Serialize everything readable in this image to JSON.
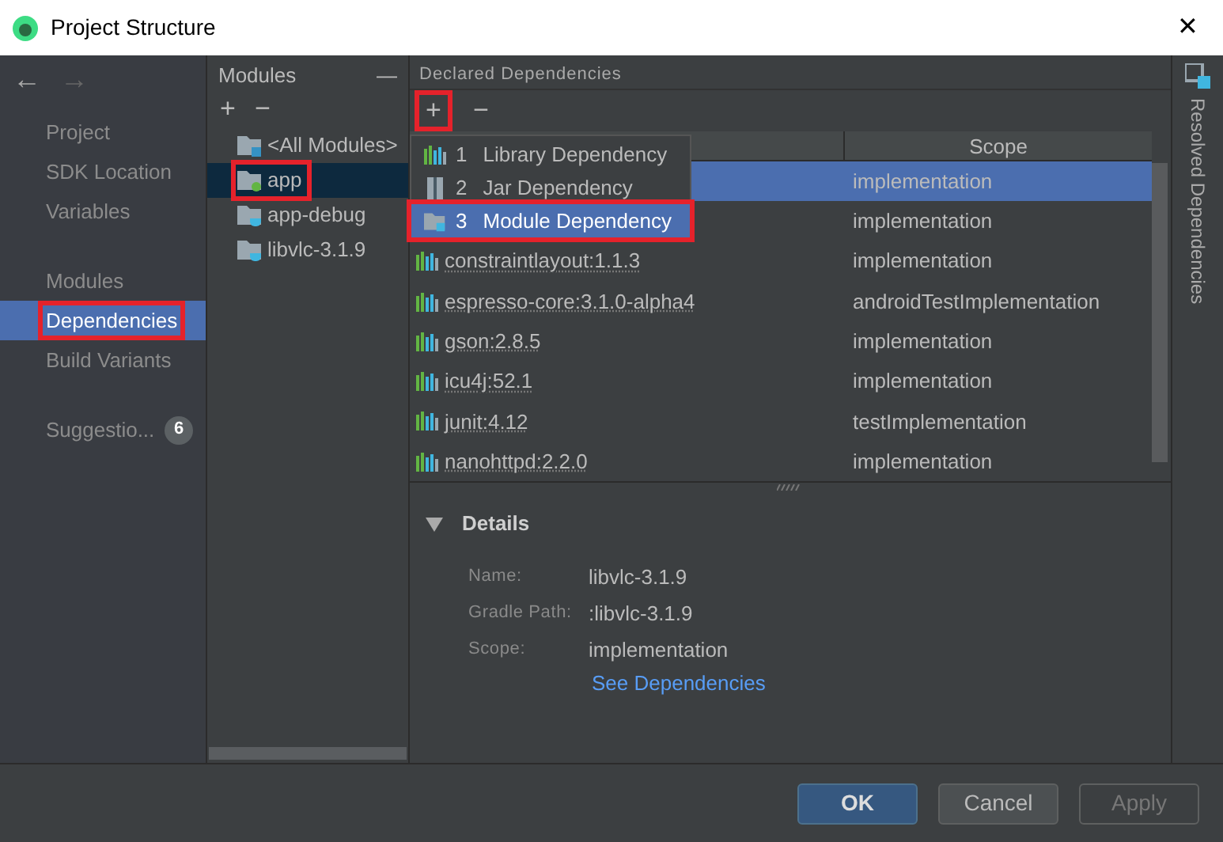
{
  "window": {
    "title": "Project Structure",
    "close": "✕"
  },
  "nav": {
    "back": "←",
    "forward": "→"
  },
  "sidebar": {
    "groups": [
      {
        "items": [
          {
            "label": "Project",
            "selected": false,
            "outlined": false
          },
          {
            "label": "SDK Location",
            "selected": false,
            "outlined": false
          },
          {
            "label": "Variables",
            "selected": false,
            "outlined": false
          }
        ]
      },
      {
        "items": [
          {
            "label": "Modules",
            "selected": false,
            "outlined": false
          },
          {
            "label": "Dependencies",
            "selected": true,
            "outlined": true
          },
          {
            "label": "Build Variants",
            "selected": false,
            "outlined": false
          }
        ]
      },
      {
        "items": [
          {
            "label": "Suggestio...",
            "selected": false,
            "outlined": false,
            "badge": "6"
          }
        ]
      }
    ]
  },
  "modules": {
    "title": "Modules",
    "collapse": "—",
    "add": "+",
    "remove": "−",
    "items": [
      {
        "label": "<All Modules>",
        "kind": "all",
        "selected": false,
        "outlined": false
      },
      {
        "label": "app",
        "kind": "app",
        "selected": true,
        "outlined": true
      },
      {
        "label": "app-debug",
        "kind": "lib",
        "selected": false,
        "outlined": false
      },
      {
        "label": "libvlc-3.1.9",
        "kind": "lib",
        "selected": false,
        "outlined": false
      }
    ]
  },
  "dependencies": {
    "title": "Declared Dependencies",
    "add": "+",
    "add_outlined": true,
    "remove": "−",
    "columns": [
      "Scope"
    ],
    "rows": [
      {
        "name": null,
        "scope": "implementation",
        "selected": true
      },
      {
        "name": null,
        "scope": "implementation",
        "selected": false
      },
      {
        "name": "constraintlayout:1.1.3",
        "scope": "implementation",
        "selected": false
      },
      {
        "name": "espresso-core:3.1.0-alpha4",
        "scope": "androidTestImplementation",
        "selected": false
      },
      {
        "name": "gson:2.8.5",
        "scope": "implementation",
        "selected": false
      },
      {
        "name": "icu4j:52.1",
        "scope": "implementation",
        "selected": false
      },
      {
        "name": "junit:4.12",
        "scope": "testImplementation",
        "selected": false
      },
      {
        "name": "nanohttpd:2.2.0",
        "scope": "implementation",
        "selected": false
      }
    ],
    "menu": [
      {
        "number": "1",
        "label": "Library Dependency",
        "kind": "library",
        "selected": false,
        "outlined": false
      },
      {
        "number": "2",
        "label": "Jar Dependency",
        "kind": "jar",
        "selected": false,
        "outlined": false
      },
      {
        "number": "3",
        "label": "Module Dependency",
        "kind": "module",
        "selected": true,
        "outlined": true
      }
    ]
  },
  "details": {
    "title": "Details",
    "expanded": true,
    "fields": [
      {
        "label": "Name:",
        "value": "libvlc-3.1.9"
      },
      {
        "label": "Gradle Path:",
        "value": ":libvlc-3.1.9"
      },
      {
        "label": "Scope:",
        "value": "implementation"
      }
    ],
    "link": "See Dependencies"
  },
  "side_tab": "Resolved Dependencies",
  "buttons": [
    {
      "label": "OK",
      "kind": "primary"
    },
    {
      "label": "Cancel",
      "kind": "normal"
    },
    {
      "label": "Apply",
      "kind": "disabled"
    }
  ]
}
